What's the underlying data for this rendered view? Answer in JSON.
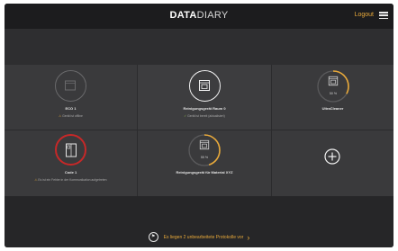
{
  "header": {
    "logo_bold": "DATA",
    "logo_light": "DIARY",
    "logout_label": "Logout"
  },
  "devices": [
    {
      "name": "ECO 1",
      "status": "Gerät ist offline",
      "state": "offline",
      "icon": "box-device-icon"
    },
    {
      "name": "Reinigungsgerät Raum 0",
      "status": "Gerät ist bereit (aktualisiert)",
      "state": "ready",
      "icon": "washer-device-icon"
    },
    {
      "name": "UltraCleaner",
      "status": "",
      "state": "running",
      "progress_label": "50 %",
      "progress": 0.33,
      "icon": "washer-device-icon"
    },
    {
      "name": "Code 1",
      "status": "Es ist ein Fehler in der Kommunikation aufgetreten",
      "state": "error",
      "icon": "cabinet-device-icon"
    },
    {
      "name": "Reinigungsgerät für Material XYZ",
      "status": "",
      "state": "running",
      "progress_label": "55 %",
      "progress": 0.45,
      "icon": "washer-device-icon"
    }
  ],
  "add_tile_icon": "plus-icon",
  "footer": {
    "banner_text": "Es liegen 2 unbearbeitete Protokolle vor",
    "banner_icon": "flag-icon"
  },
  "colors": {
    "accent": "#e8a93a",
    "error": "#c62828",
    "ok": "#8fb84e",
    "inactive": "#6a6a6c"
  }
}
